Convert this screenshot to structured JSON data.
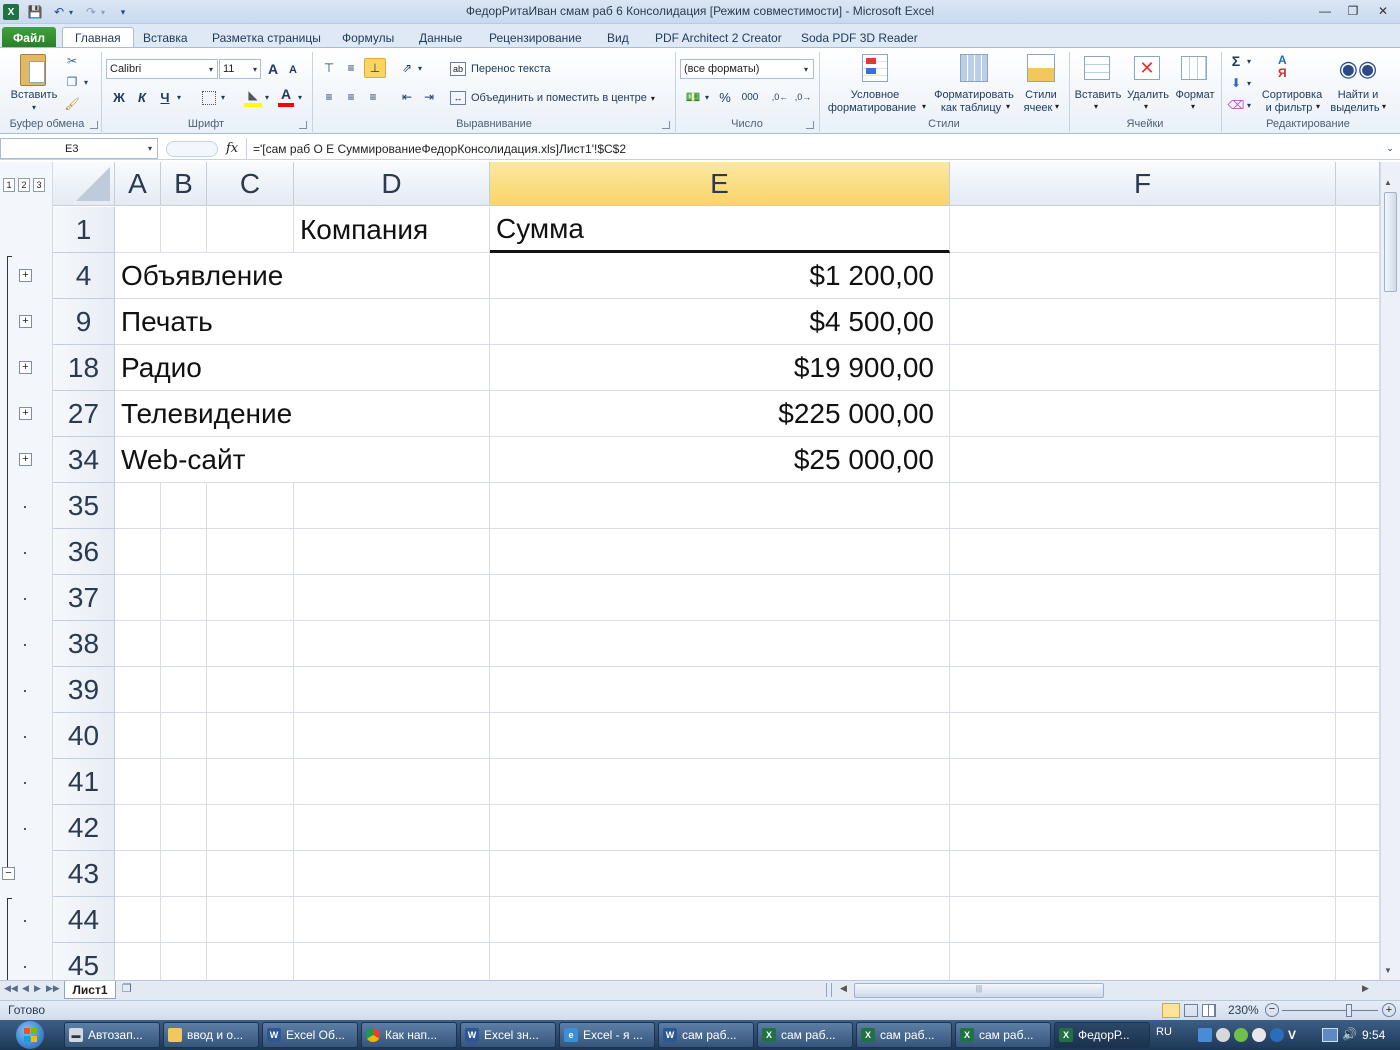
{
  "window": {
    "title": "ФедорРитаИван смам раб 6 Консолидация  [Режим совместимости]  -  Microsoft Excel",
    "app_icon": "excel-icon"
  },
  "tabs": [
    "Файл",
    "Главная",
    "Вставка",
    "Разметка страницы",
    "Формулы",
    "Данные",
    "Рецензирование",
    "Вид",
    "PDF Architect 2 Creator",
    "Soda PDF 3D Reader"
  ],
  "active_tab": "Главная",
  "ribbon": {
    "clipboard": {
      "paste": "Вставить",
      "label": "Буфер обмена"
    },
    "font": {
      "name": "Calibri",
      "size": "11",
      "label": "Шрифт",
      "bold": "Ж",
      "italic": "К",
      "underline": "Ч",
      "grow": "A",
      "shrink": "A",
      "font_color_letter": "A"
    },
    "alignment": {
      "wrap": "Перенос текста",
      "merge": "Объединить и поместить в центре",
      "label": "Выравнивание"
    },
    "number": {
      "format": "(все форматы)",
      "percent": "%",
      "thousands": "000",
      "label": "Число"
    },
    "styles": {
      "conditional": [
        "Условное",
        "форматирование"
      ],
      "table": [
        "Форматировать",
        "как таблицу"
      ],
      "cell": [
        "Стили",
        "ячеек"
      ],
      "label": "Стили"
    },
    "cells": {
      "insert": "Вставить",
      "delete": "Удалить",
      "format": "Формат",
      "label": "Ячейки"
    },
    "editing": {
      "sort": [
        "Сортировка",
        "и фильтр"
      ],
      "find": [
        "Найти и",
        "выделить"
      ],
      "label": "Редактирование",
      "sigma": "Σ"
    }
  },
  "formula_bar": {
    "name_box": "E3",
    "fx": "fx",
    "formula": "='[сам раб О Е СуммированиеФедорКонсолидация.xls]Лист1'!$C$2"
  },
  "outline_levels": [
    "1",
    "2",
    "3"
  ],
  "columns": [
    "A",
    "B",
    "C",
    "D",
    "E",
    "F"
  ],
  "selected_column": "E",
  "rows": [
    {
      "num": "1",
      "a": "",
      "d": "Компания",
      "e": "Сумма",
      "outline": "none"
    },
    {
      "num": "4",
      "a": "Объявление",
      "d": "",
      "e": "$1 200,00",
      "outline": "plus"
    },
    {
      "num": "9",
      "a": "Печать",
      "d": "",
      "e": "$4 500,00",
      "outline": "plus"
    },
    {
      "num": "18",
      "a": "Радио",
      "d": "",
      "e": "$19 900,00",
      "outline": "plus"
    },
    {
      "num": "27",
      "a": "Телевидение",
      "d": "",
      "e": "$225 000,00",
      "outline": "plus"
    },
    {
      "num": "34",
      "a": "Web-сайт",
      "d": "",
      "e": "$25 000,00",
      "outline": "plus"
    },
    {
      "num": "35",
      "a": "",
      "d": "",
      "e": "",
      "outline": "dot"
    },
    {
      "num": "36",
      "a": "",
      "d": "",
      "e": "",
      "outline": "dot"
    },
    {
      "num": "37",
      "a": "",
      "d": "",
      "e": "",
      "outline": "dot"
    },
    {
      "num": "38",
      "a": "",
      "d": "",
      "e": "",
      "outline": "dot"
    },
    {
      "num": "39",
      "a": "",
      "d": "",
      "e": "",
      "outline": "dot"
    },
    {
      "num": "40",
      "a": "",
      "d": "",
      "e": "",
      "outline": "dot"
    },
    {
      "num": "41",
      "a": "",
      "d": "",
      "e": "",
      "outline": "dot"
    },
    {
      "num": "42",
      "a": "",
      "d": "",
      "e": "",
      "outline": "dot"
    },
    {
      "num": "43",
      "a": "",
      "d": "",
      "e": "",
      "outline": "minus"
    },
    {
      "num": "44",
      "a": "",
      "d": "",
      "e": "",
      "outline": "dot"
    },
    {
      "num": "45",
      "a": "",
      "d": "",
      "e": "",
      "outline": "dot"
    }
  ],
  "sheet_tabs": [
    "Лист1"
  ],
  "status": {
    "ready": "Готово",
    "zoom": "230%"
  },
  "taskbar": {
    "items": [
      {
        "label": "Автозап...",
        "icon": "car-icon"
      },
      {
        "label": "ввод и о...",
        "icon": "folder-icon"
      },
      {
        "label": "Excel Об...",
        "icon": "word-icon"
      },
      {
        "label": "Как нап...",
        "icon": "chrome-icon"
      },
      {
        "label": "Excel зн...",
        "icon": "word-icon"
      },
      {
        "label": "Excel - я ...",
        "icon": "ie-icon"
      },
      {
        "label": "сам раб...",
        "icon": "word-icon"
      },
      {
        "label": "сам раб...",
        "icon": "excel-icon"
      },
      {
        "label": "сам раб...",
        "icon": "excel-icon"
      },
      {
        "label": "сам раб...",
        "icon": "excel-icon"
      },
      {
        "label": "ФедорР...",
        "icon": "excel-icon",
        "active": true
      }
    ],
    "lang": "RU",
    "time": "9:54"
  },
  "colors": {
    "accent": "#2a7d2a",
    "selected_header": "#f8d56a",
    "taskbar": "#1d3756"
  }
}
